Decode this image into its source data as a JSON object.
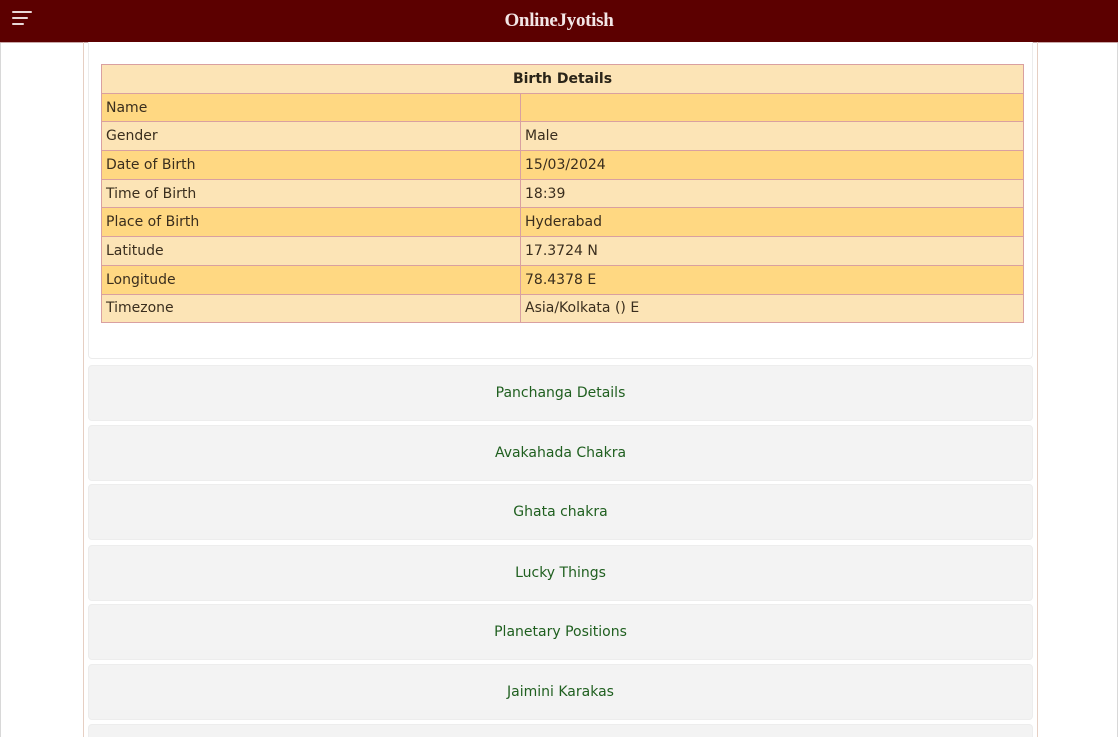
{
  "header": {
    "brand": "OnlineJyotish",
    "colors": {
      "bar": "#5c0000",
      "brand_text": "#f3e6e6"
    },
    "menu_icon": "hamburger-menu-icon"
  },
  "birth_details": {
    "title": "Birth Details",
    "rows": [
      {
        "label": "Name",
        "value": ""
      },
      {
        "label": "Gender",
        "value": "Male"
      },
      {
        "label": "Date of Birth",
        "value": "15/03/2024"
      },
      {
        "label": "Time of Birth",
        "value": "18:39"
      },
      {
        "label": "Place of Birth",
        "value": "Hyderabad"
      },
      {
        "label": "Latitude",
        "value": "17.3724 N"
      },
      {
        "label": "Longitude",
        "value": "78.4378 E"
      },
      {
        "label": "Timezone",
        "value": "Asia/Kolkata () E"
      }
    ],
    "colors": {
      "header_row": "#fce4b6",
      "odd_row": "#ffd882",
      "even_row": "#fce4b6",
      "border": "#d9a0a0"
    }
  },
  "sections": [
    {
      "label": "Panchanga Details"
    },
    {
      "label": "Avakahada Chakra"
    },
    {
      "label": "Ghata chakra"
    },
    {
      "label": "Lucky Things"
    },
    {
      "label": "Planetary Positions"
    },
    {
      "label": "Jaimini Karakas"
    }
  ]
}
